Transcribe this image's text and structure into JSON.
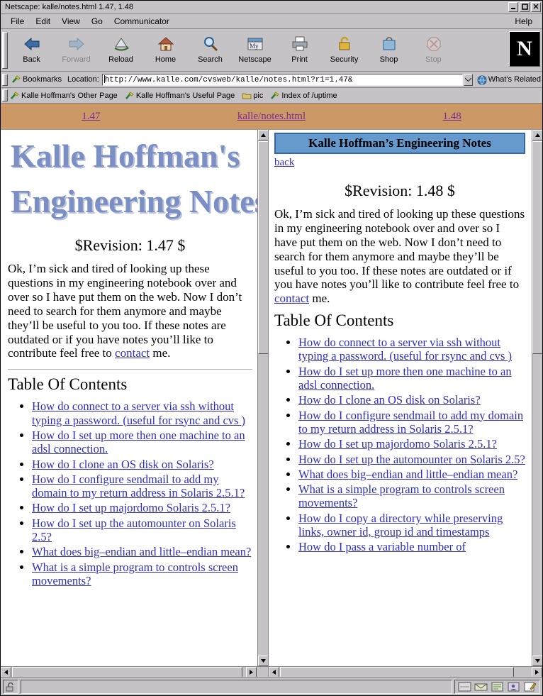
{
  "window": {
    "title": "Netscape: kalle/notes.html 1.47, 1.48",
    "minimize_label": "_",
    "maximize_label": "□",
    "close_label": "✕"
  },
  "menu": {
    "items": [
      "File",
      "Edit",
      "View",
      "Go",
      "Communicator"
    ],
    "help": "Help"
  },
  "toolbar": {
    "items": [
      {
        "label": "Back",
        "icon": "back-arrow-icon",
        "disabled": false
      },
      {
        "label": "Forward",
        "icon": "forward-arrow-icon",
        "disabled": true
      },
      {
        "label": "Reload",
        "icon": "reload-icon",
        "disabled": false
      },
      {
        "label": "Home",
        "icon": "home-icon",
        "disabled": false
      },
      {
        "label": "Search",
        "icon": "search-icon",
        "disabled": false
      },
      {
        "label": "Netscape",
        "icon": "netscape-my-icon",
        "disabled": false
      },
      {
        "label": "Print",
        "icon": "printer-icon",
        "disabled": false
      },
      {
        "label": "Security",
        "icon": "padlock-icon",
        "disabled": false
      },
      {
        "label": "Shop",
        "icon": "shopping-bag-icon",
        "disabled": false
      },
      {
        "label": "Stop",
        "icon": "stop-sign-icon",
        "disabled": true
      }
    ],
    "logo_letter": "N"
  },
  "location_bar": {
    "bookmarks_label": "Bookmarks",
    "bookmarks_icon": "bookmark-icon",
    "location_label": "Location:",
    "url_value": "http://www.kalle.com/cvsweb/kalle/notes.html?r1=1.47&",
    "whats_related_label": "What's Related",
    "whats_related_icon": "globe-icon"
  },
  "personal_toolbar": {
    "items": [
      {
        "label": "Kalle Hoffman's Other Page",
        "icon": "bookmark-icon"
      },
      {
        "label": "Kalle Hoffman's Useful Page",
        "icon": "bookmark-icon"
      },
      {
        "label": "pic",
        "icon": "folder-icon"
      },
      {
        "label": "Index of /uptime",
        "icon": "bookmark-icon"
      }
    ]
  },
  "diff_header": {
    "left_revision": "1.47",
    "center_file": "kalle/notes.html",
    "right_revision": "1.48"
  },
  "left_pane": {
    "banner_line1": "Kalle Hoffman's",
    "banner_line2": "Engineering Notes",
    "revision": "$Revision: 1.47 $",
    "intro_before": "Ok, I’m sick and tired of looking up these questions in my engineering notebook over and over so I have put them on the web. Now I don’t need to search for them anymore and maybe they’ll be useful to you too. If these notes are outdated or if you have notes you’ll like to contribute feel free to ",
    "intro_link": "contact",
    "intro_after": " me.",
    "toc_heading": "Table Of Contents",
    "toc_items": [
      "How do connect to a server via ssh without typing a password. (useful for rsync and cvs )",
      "How do I set up more then one machine to an adsl connection.",
      "How do I clone an OS disk on Solaris? ",
      "How do I configure sendmail to add my domain to my return address in Solaris 2.5.1?",
      "How do I set up majordomo Solaris 2.5.1?",
      "How do I set up the automounter on Solaris 2.5? ",
      "What does big–endian and little–endian mean?",
      "What is a simple program to controls screen movements?"
    ]
  },
  "right_pane": {
    "title_banner": "Kalle Hoffman’s Engineering Notes",
    "back_link": "back",
    "revision": "$Revision: 1.48 $",
    "intro_before": "Ok, I’m sick and tired of looking up these questions in my engineering notebook over and over so I have put them on the web. Now I don’t need to search for them anymore and maybe they’ll be useful to you too. If these notes are outdated or if you have notes you’ll like to contribute feel free to ",
    "intro_link": "contact",
    "intro_after": " me.",
    "toc_heading": "Table Of Contents",
    "toc_items": [
      "How do connect to a server via ssh without typing a password. (useful for rsync and cvs )",
      "How do I set up more then one machine to an adsl connection.",
      "How do I clone an OS disk on Solaris?",
      "How do I configure sendmail to add my domain to my return address in Solaris 2.5.1?",
      "How do I set up majordomo Solaris 2.5.1?",
      "How do I set up the automounter on Solaris 2.5?",
      "What does big–endian and little–endian mean?",
      "What is a simple program to controls screen movements?",
      "How do I copy a directory while preserving links, owner id, group id and timestamps",
      "How do I pass a variable number of"
    ]
  },
  "status_bar": {
    "status_text": "",
    "lock_icon": "unlocked-padlock-icon",
    "component_icons": [
      "navigator-icon",
      "mailbox-icon",
      "newsgroup-icon",
      "address-book-icon",
      "composer-icon"
    ]
  },
  "colors": {
    "chrome": "#c6c3c6",
    "diff_header_bg": "#cc9966",
    "link": "#2f2fbf",
    "visited_link": "#7b2c8e",
    "right_title_bg": "#6699cc",
    "banner_text": "#7b8fc4"
  }
}
